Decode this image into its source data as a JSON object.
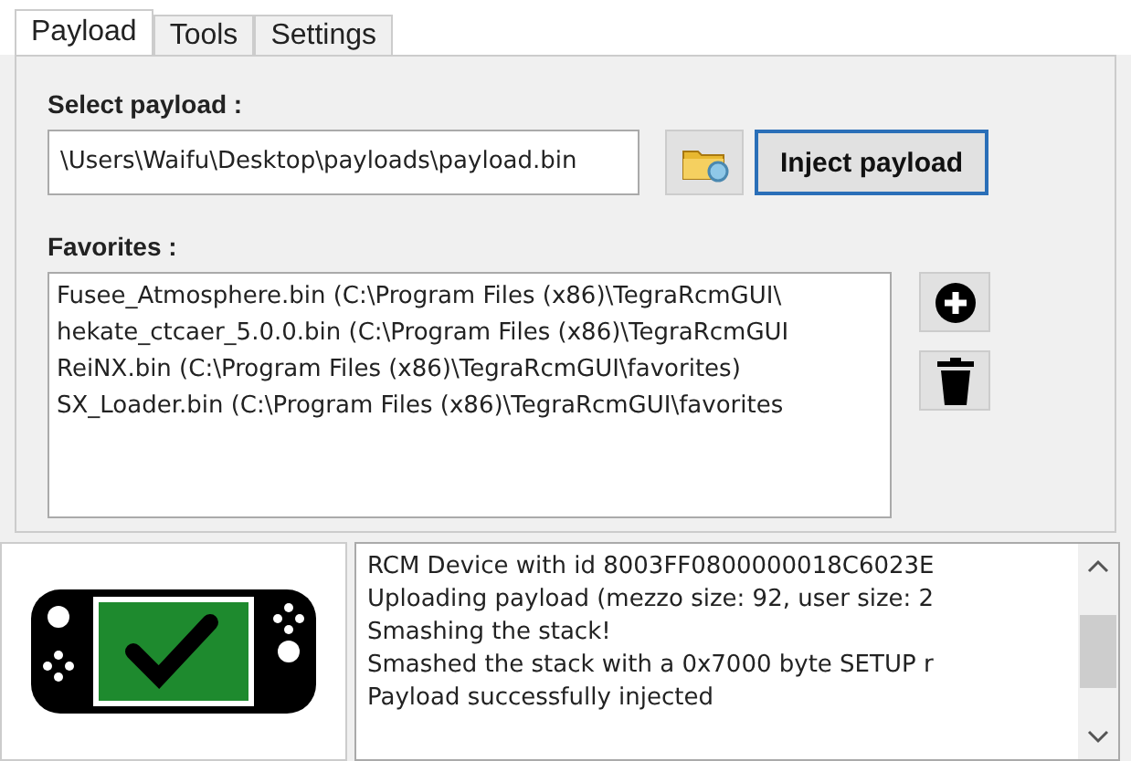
{
  "tabs": [
    {
      "label": "Payload",
      "selected": true
    },
    {
      "label": "Tools",
      "selected": false
    },
    {
      "label": "Settings",
      "selected": false
    }
  ],
  "select_payload": {
    "label": "Select payload :",
    "value": "\\Users\\Waifu\\Desktop\\payloads\\payload.bin",
    "inject_button": "Inject payload"
  },
  "favorites": {
    "label": "Favorites :",
    "items": [
      "Fusee_Atmosphere.bin (C:\\Program Files (x86)\\TegraRcmGUI\\",
      "hekate_ctcaer_5.0.0.bin (C:\\Program Files (x86)\\TegraRcmGUI",
      "ReiNX.bin (C:\\Program Files (x86)\\TegraRcmGUI\\favorites)",
      "SX_Loader.bin (C:\\Program Files (x86)\\TegraRcmGUI\\favorites"
    ]
  },
  "status": {
    "injected": true
  },
  "log": [
    "RCM Device with id 8003FF0800000018C6023E",
    "Uploading payload (mezzo size: 92, user size: 2",
    "Smashing the stack!",
    "Smashed the stack with a 0x7000 byte SETUP r",
    "Payload successfully injected"
  ]
}
